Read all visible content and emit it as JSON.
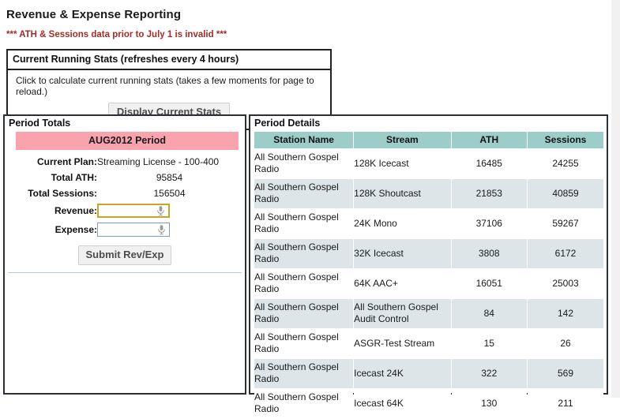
{
  "page": {
    "title": "Revenue & Expense Reporting",
    "invalid_note": "*** ATH & Sessions data prior to July 1 is invalid ***"
  },
  "running_stats": {
    "header": "Current Running Stats (refreshes every 4 hours)",
    "description": "Click to calculate current running stats (takes a few moments for page to reload.)",
    "button_label": "Display Current Stats"
  },
  "period_totals": {
    "panel_title": "Period Totals",
    "period_badge": "AUG2012 Period",
    "badge_color": "#f8a3ae",
    "labels": {
      "current_plan": "Current Plan:",
      "total_ath": "Total ATH:",
      "total_sessions": "Total Sessions:",
      "revenue": "Revenue:",
      "expense": "Expense:"
    },
    "values": {
      "current_plan": "Streaming License - 100-400",
      "total_ath": "95854",
      "total_sessions": "156504",
      "revenue": "",
      "expense": ""
    },
    "placeholders": {
      "revenue": "",
      "expense": ""
    },
    "submit_label": "Submit Rev/Exp",
    "revenue_focus_color": "#c9a227",
    "expense_border_color": "#7f9db9"
  },
  "period_details": {
    "panel_title": "Period Details",
    "header_color": "#9ccdc9",
    "alt_row_color": "#dde5e9",
    "columns": [
      "Station Name",
      "Stream",
      "ATH",
      "Sessions"
    ],
    "rows": [
      {
        "station": "All Southern Gospel Radio",
        "stream": "128K Icecast",
        "ath": "16485",
        "sessions": "24255"
      },
      {
        "station": "All Southern Gospel Radio",
        "stream": "128K Shoutcast",
        "ath": "21853",
        "sessions": "40859"
      },
      {
        "station": "All Southern Gospel Radio",
        "stream": "24K Mono",
        "ath": "37106",
        "sessions": "59267"
      },
      {
        "station": "All Southern Gospel Radio",
        "stream": "32K Icecast",
        "ath": "3808",
        "sessions": "6172"
      },
      {
        "station": "All Southern Gospel Radio",
        "stream": "64K AAC+",
        "ath": "16051",
        "sessions": "25003"
      },
      {
        "station": "All Southern Gospel Radio",
        "stream": "All Southern Gospel Audit Control",
        "ath": "84",
        "sessions": "142"
      },
      {
        "station": "All Southern Gospel Radio",
        "stream": "ASGR-Test Stream",
        "ath": "15",
        "sessions": "26"
      },
      {
        "station": "All Southern Gospel Radio",
        "stream": "Icecast 24K",
        "ath": "322",
        "sessions": "569"
      },
      {
        "station": "All Southern Gospel Radio",
        "stream": "Icecast 64K",
        "ath": "130",
        "sessions": "211"
      }
    ]
  },
  "icons": {
    "microphone": "microphone-icon"
  }
}
